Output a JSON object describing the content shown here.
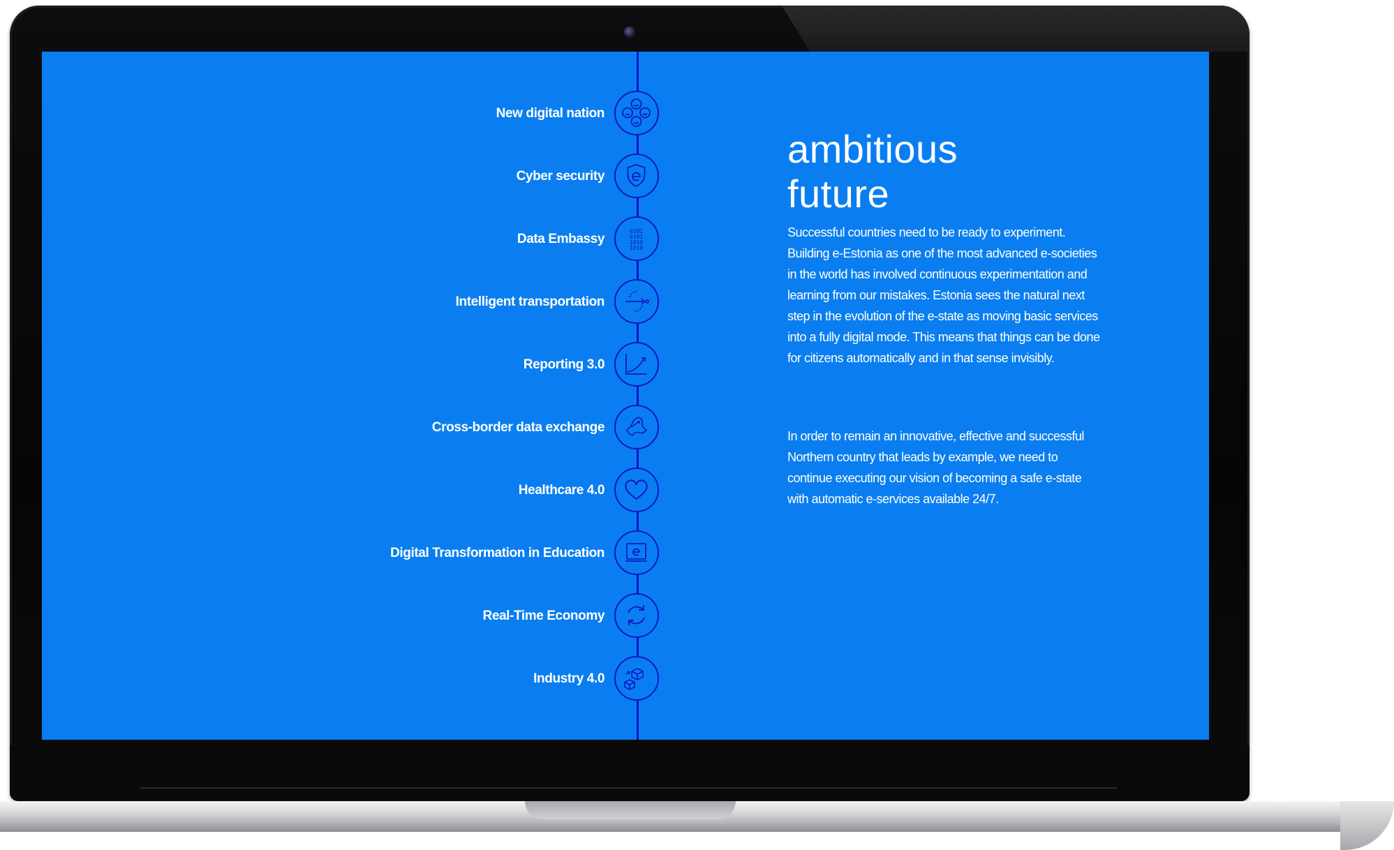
{
  "colors": {
    "screen_bg": "#0a7ef0",
    "accent_line": "#0b18c9",
    "text": "#ffffff"
  },
  "timeline": {
    "items": [
      {
        "label": "New digital nation",
        "icon": "people-network-icon"
      },
      {
        "label": "Cyber security",
        "icon": "shield-e-icon"
      },
      {
        "label": "Data Embassy",
        "icon": "binary-data-icon"
      },
      {
        "label": "Intelligent transportation",
        "icon": "route-arrows-icon"
      },
      {
        "label": "Reporting 3.0",
        "icon": "growth-chart-icon"
      },
      {
        "label": "Cross-border data exchange",
        "icon": "map-exchange-icon"
      },
      {
        "label": "Healthcare 4.0",
        "icon": "heart-icon"
      },
      {
        "label": "Digital Transformation in Education",
        "icon": "book-e-icon"
      },
      {
        "label": "Real-Time Economy",
        "icon": "cycle-arrows-icon"
      },
      {
        "label": "Industry 4.0",
        "icon": "boxes-icon"
      }
    ]
  },
  "content": {
    "title_line1": "ambitious",
    "title_line2": "future",
    "paragraph1": "Successful countries need to be ready to experiment. Building e-Estonia as one of the most advanced e-societies in the world has involved continuous experimentation and learning from our mistakes. Estonia sees the natural next step in the evolution of the e-state as moving basic services into a fully digital mode. This means that things can be done for citizens automatically and in that sense invisibly.",
    "paragraph2": "In order to remain an innovative, effective and successful Northern country that leads by example, we need to continue executing our vision of becoming a safe e-state with automatic e-services available 24/7."
  }
}
